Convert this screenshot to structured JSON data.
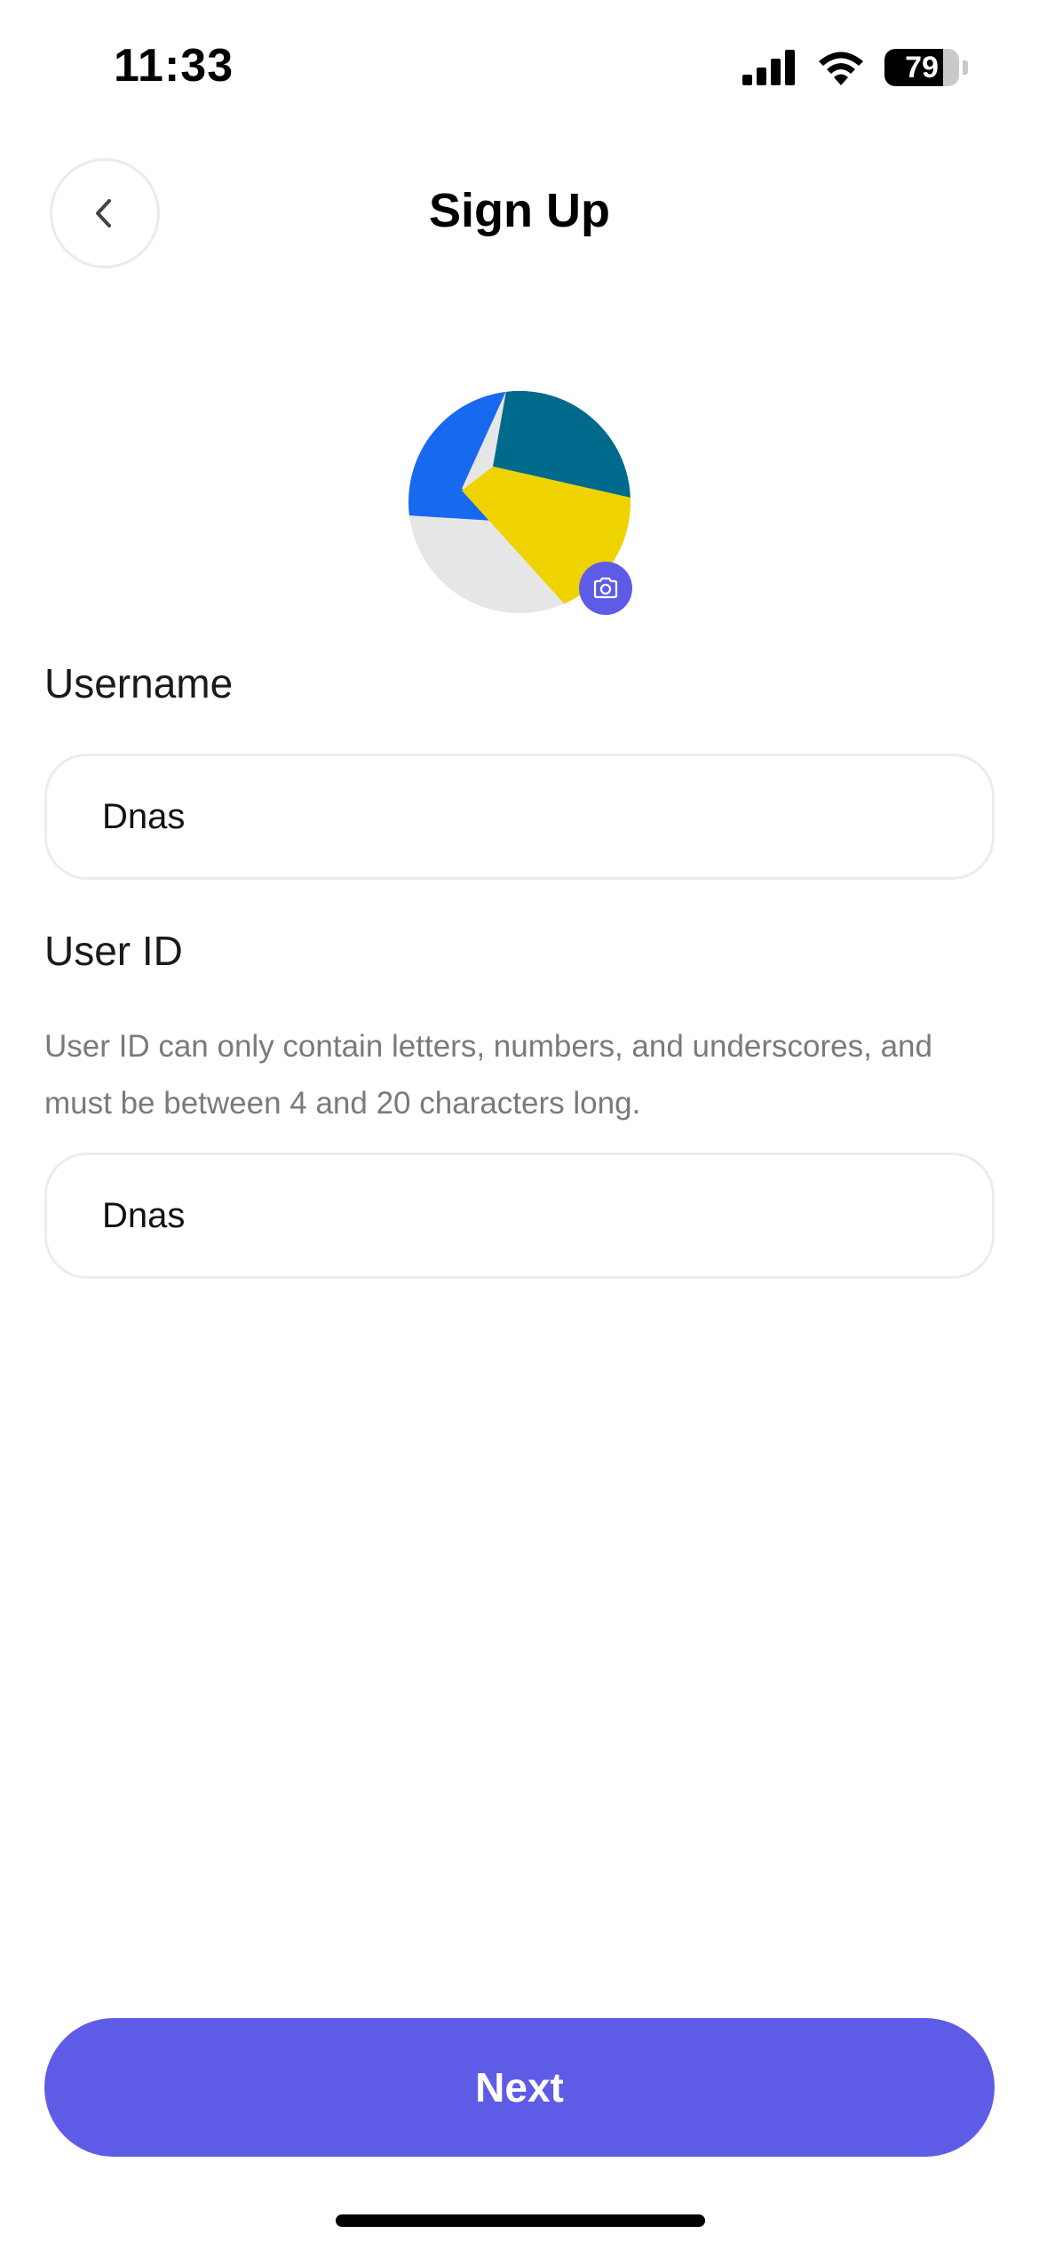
{
  "status_bar": {
    "time": "11:33",
    "battery": "79",
    "battery_level": 0.79,
    "icons": [
      "cellular-signal-icon",
      "wifi-icon",
      "battery-icon"
    ]
  },
  "header": {
    "title": "Sign Up",
    "back_icon": "chevron-left-icon"
  },
  "avatar": {
    "badge_icon": "camera-icon",
    "colors": [
      "#1769f0",
      "#006a8c",
      "#efd300",
      "#e6e6e6"
    ]
  },
  "form": {
    "username": {
      "label": "Username",
      "value": "Dnas"
    },
    "user_id": {
      "label": "User ID",
      "helper": "User ID can only contain letters, numbers, and underscores, and must be between 4 and 20 characters long.",
      "value": "Dnas"
    }
  },
  "footer": {
    "next_label": "Next"
  },
  "colors": {
    "accent": "#5e5ce6",
    "field_border": "#ececec",
    "helper_text": "#7a7a7a"
  }
}
